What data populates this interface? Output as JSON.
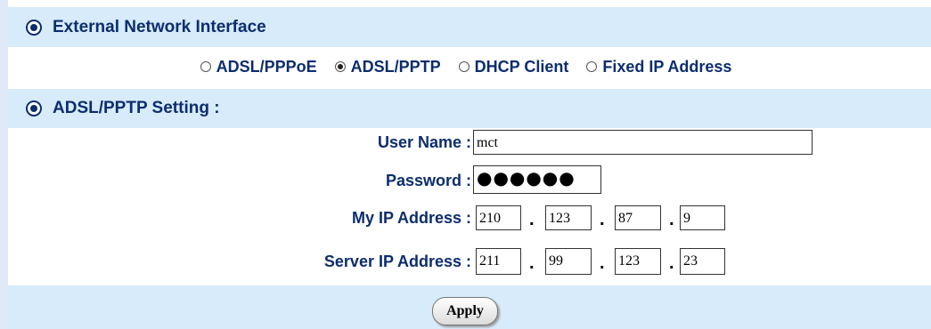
{
  "external": {
    "title": "External Network Interface",
    "modes": [
      {
        "label": "ADSL/PPPoE",
        "selected": false
      },
      {
        "label": "ADSL/PPTP",
        "selected": true
      },
      {
        "label": "DHCP Client",
        "selected": false
      },
      {
        "label": "Fixed IP Address",
        "selected": false
      }
    ]
  },
  "pptp": {
    "title": "ADSL/PPTP Setting :",
    "user_name_label": "User Name :",
    "user_name_value": "mct",
    "password_label": "Password :",
    "password_mask": "●●●●●●",
    "my_ip_label": "My IP Address :",
    "my_ip": [
      "210",
      "123",
      "87",
      "9"
    ],
    "server_ip_label": "Server IP Address :",
    "server_ip": [
      "211",
      "99",
      "123",
      "23"
    ],
    "ip_separator": "."
  },
  "apply_label": "Apply"
}
